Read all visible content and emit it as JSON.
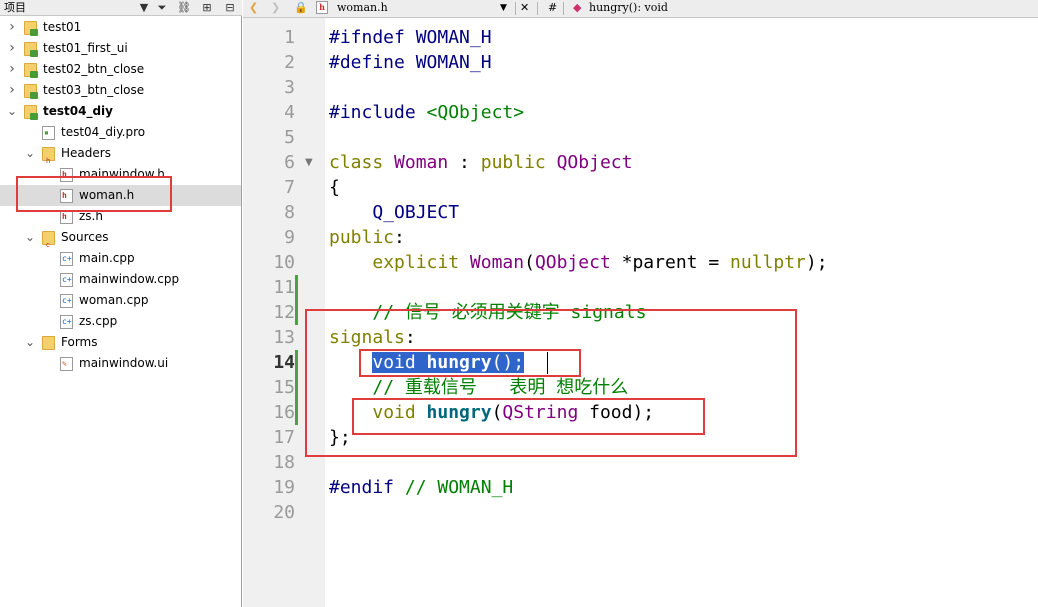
{
  "project_pane": {
    "title": "项目",
    "tree": [
      {
        "label": "test01",
        "kind": "project",
        "expanded": false
      },
      {
        "label": "test01_first_ui",
        "kind": "project",
        "expanded": false
      },
      {
        "label": "test02_btn_close",
        "kind": "project",
        "expanded": false
      },
      {
        "label": "test03_btn_close",
        "kind": "project",
        "expanded": false
      },
      {
        "label": "test04_diy",
        "kind": "project",
        "expanded": true,
        "active": true
      },
      {
        "label": "test04_diy.pro",
        "kind": "pro-file"
      },
      {
        "label": "Headers",
        "kind": "folder",
        "expanded": true
      },
      {
        "label": "mainwindow.h",
        "kind": "header-file"
      },
      {
        "label": "woman.h",
        "kind": "header-file",
        "selected": true
      },
      {
        "label": "zs.h",
        "kind": "header-file"
      },
      {
        "label": "Sources",
        "kind": "folder",
        "expanded": true
      },
      {
        "label": "main.cpp",
        "kind": "source-file"
      },
      {
        "label": "mainwindow.cpp",
        "kind": "source-file"
      },
      {
        "label": "woman.cpp",
        "kind": "source-file"
      },
      {
        "label": "zs.cpp",
        "kind": "source-file"
      },
      {
        "label": "Forms",
        "kind": "folder",
        "expanded": true
      },
      {
        "label": "mainwindow.ui",
        "kind": "ui-file"
      }
    ]
  },
  "editor_toolbar": {
    "file_name": "woman.h",
    "hash": "#",
    "symbol": "hungry(): void"
  },
  "editor": {
    "current_line": 14,
    "line_numbers": [
      "1",
      "2",
      "3",
      "4",
      "5",
      "6",
      "7",
      "8",
      "9",
      "10",
      "11",
      "12",
      "13",
      "14",
      "15",
      "16",
      "17",
      "18",
      "19",
      "20"
    ],
    "lines": [
      [
        [
          "pp",
          "#ifndef WOMAN_H"
        ]
      ],
      [
        [
          "pp",
          "#define WOMAN_H"
        ]
      ],
      [],
      [
        [
          "pp",
          "#include "
        ],
        [
          "str",
          "<QObject>"
        ]
      ],
      [],
      [
        [
          "kw",
          "class "
        ],
        [
          "typ",
          "Woman"
        ],
        [
          "plain",
          " : "
        ],
        [
          "kw",
          "public "
        ],
        [
          "typ",
          "QObject"
        ]
      ],
      [
        [
          "plain",
          "{"
        ]
      ],
      [
        [
          "plain",
          "    "
        ],
        [
          "pp",
          "Q_OBJECT"
        ]
      ],
      [
        [
          "kw",
          "public"
        ],
        [
          "plain",
          ":"
        ]
      ],
      [
        [
          "plain",
          "    "
        ],
        [
          "kw",
          "explicit "
        ],
        [
          "typ",
          "Woman"
        ],
        [
          "plain",
          "("
        ],
        [
          "typ",
          "QObject"
        ],
        [
          "plain",
          " *parent = "
        ],
        [
          "kw",
          "nullptr"
        ],
        [
          "plain",
          ");"
        ]
      ],
      [],
      [
        [
          "plain",
          "    "
        ],
        [
          "cm",
          "// 信号 必须用关键字 signals"
        ]
      ],
      [
        [
          "kw",
          "signals"
        ],
        [
          "plain",
          ":"
        ]
      ],
      [
        [
          "plain",
          "    "
        ],
        [
          "sel-kw",
          "void "
        ],
        [
          "sel-fn",
          "hungry"
        ],
        [
          "sel",
          "();"
        ]
      ],
      [
        [
          "plain",
          "    "
        ],
        [
          "cm",
          "// 重载信号   表明 想吃什么"
        ]
      ],
      [
        [
          "plain",
          "    "
        ],
        [
          "kw",
          "void "
        ],
        [
          "fn",
          "hungry"
        ],
        [
          "plain",
          "("
        ],
        [
          "typ",
          "QString"
        ],
        [
          "plain",
          " food);"
        ]
      ],
      [
        [
          "plain",
          "};"
        ]
      ],
      [],
      [
        [
          "pp",
          "#endif"
        ],
        [
          "plain",
          " "
        ],
        [
          "cm",
          "// WOMAN_H"
        ]
      ],
      []
    ]
  },
  "colors": {
    "keyword": "#808000",
    "preprocessor": "#000080",
    "type": "#800080",
    "comment": "#008000",
    "function": "#00677c",
    "selection": "#2f65ca",
    "annotation_box": "#e03c3c"
  }
}
